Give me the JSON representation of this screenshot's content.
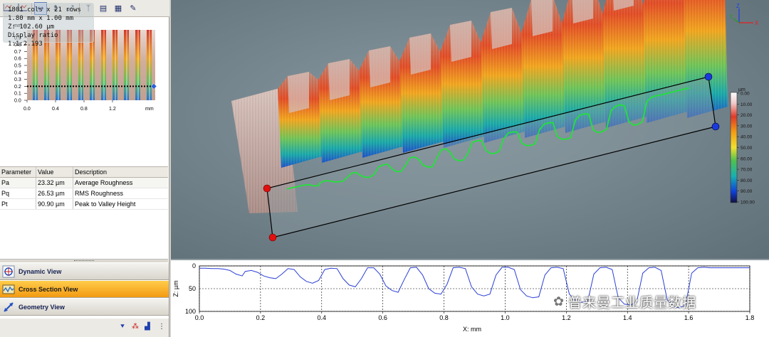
{
  "toolbar": {
    "buttons": [
      {
        "icon": "profile-fit-icon"
      },
      {
        "icon": "profile-level-icon"
      },
      {
        "icon": "horizontal-measure-icon",
        "glyph": "↔",
        "active": true
      },
      {
        "icon": "vertical-measure-icon",
        "glyph": "↕"
      },
      {
        "icon": "diagonal-measure-icon",
        "glyph": "⤢"
      },
      {
        "icon": "step-height-icon",
        "glyph": "ᛉ"
      },
      {
        "icon": "table-icon",
        "glyph": "▤"
      },
      {
        "icon": "pattern-icon",
        "glyph": "▦"
      },
      {
        "icon": "probe-icon",
        "glyph": "✎"
      }
    ]
  },
  "overview": {
    "unit_top": "mm",
    "unit_right": "mm",
    "y_ticks": [
      "0.0",
      "0.1",
      "0.2",
      "0.3",
      "0.4",
      "0.5",
      "0.6",
      "0.7",
      "0.8",
      "0.9"
    ],
    "x_ticks": [
      "0.0",
      "0.4",
      "0.8",
      "1.2"
    ],
    "section_y": 0.2
  },
  "params": {
    "headers": [
      "Parameter",
      "Value",
      "Description"
    ],
    "rows": [
      [
        "Pa",
        "23.32 µm",
        "Average Roughness"
      ],
      [
        "Pq",
        "26.53 µm",
        "RMS Roughness"
      ],
      [
        "Pt",
        "90.90 µm",
        "Peak to Valley Height"
      ]
    ]
  },
  "views": [
    {
      "label": "Dynamic View",
      "icon": "dynamic-view-icon",
      "active": false
    },
    {
      "label": "Cross Section View",
      "icon": "cross-section-view-icon",
      "active": true
    },
    {
      "label": "Geometry View",
      "icon": "geometry-view-icon",
      "active": false
    }
  ],
  "info": {
    "line1": "1801 cols x 21 rows",
    "line2": "1.80 mm x 1.00 mm",
    "line3": "Z: 102.60 µm",
    "line4": "Display ratio 1:1:2.193"
  },
  "axes3d": {
    "x": "X",
    "y": "Y",
    "z": "Z"
  },
  "colorbar": {
    "unit": "µm",
    "ticks": [
      "0.00",
      "10.00",
      "20.00",
      "30.00",
      "40.00",
      "50.00",
      "60.00",
      "70.00",
      "80.00",
      "90.00",
      "100.00"
    ]
  },
  "chart_data": {
    "type": "line",
    "xlabel": "X: mm",
    "ylabel": "Z: µm",
    "xlim": [
      0.0,
      1.8
    ],
    "ylim": [
      100,
      0
    ],
    "x_ticks": [
      "0.0",
      "0.2",
      "0.4",
      "0.6",
      "0.8",
      "1.0",
      "1.2",
      "1.4",
      "1.6",
      "1.8"
    ],
    "y_ticks": [
      "0",
      "50",
      "100"
    ],
    "grid": true,
    "series": [
      {
        "color": "#2a3fd6",
        "x": [
          0.0,
          0.02,
          0.04,
          0.06,
          0.08,
          0.1,
          0.12,
          0.14,
          0.15,
          0.17,
          0.19,
          0.21,
          0.23,
          0.25,
          0.27,
          0.29,
          0.31,
          0.33,
          0.35,
          0.37,
          0.39,
          0.41,
          0.43,
          0.45,
          0.47,
          0.49,
          0.51,
          0.53,
          0.55,
          0.57,
          0.59,
          0.61,
          0.63,
          0.65,
          0.67,
          0.69,
          0.71,
          0.73,
          0.75,
          0.77,
          0.79,
          0.81,
          0.83,
          0.85,
          0.87,
          0.89,
          0.91,
          0.93,
          0.95,
          0.97,
          0.99,
          1.01,
          1.03,
          1.05,
          1.07,
          1.09,
          1.11,
          1.13,
          1.15,
          1.17,
          1.19,
          1.21,
          1.23,
          1.25,
          1.27,
          1.29,
          1.31,
          1.33,
          1.35,
          1.37,
          1.39,
          1.41,
          1.43,
          1.45,
          1.47,
          1.49,
          1.51,
          1.53,
          1.55,
          1.57,
          1.59,
          1.61,
          1.63,
          1.65,
          1.67,
          1.69,
          1.71,
          1.73,
          1.75,
          1.77,
          1.8
        ],
        "y": [
          5,
          5,
          6,
          6,
          7,
          10,
          18,
          22,
          12,
          10,
          14,
          22,
          26,
          28,
          18,
          6,
          8,
          24,
          34,
          38,
          32,
          8,
          5,
          6,
          28,
          42,
          46,
          28,
          4,
          4,
          18,
          44,
          54,
          58,
          30,
          4,
          3,
          20,
          50,
          60,
          62,
          40,
          4,
          3,
          6,
          46,
          62,
          66,
          62,
          20,
          3,
          3,
          8,
          52,
          66,
          70,
          68,
          20,
          4,
          3,
          6,
          62,
          76,
          80,
          78,
          18,
          4,
          3,
          8,
          70,
          84,
          86,
          80,
          16,
          4,
          3,
          10,
          74,
          90,
          92,
          86,
          16,
          4,
          3,
          4,
          4,
          4,
          4,
          4,
          4,
          4
        ]
      }
    ]
  },
  "watermark": {
    "text": "普来曼工业质量数据"
  }
}
